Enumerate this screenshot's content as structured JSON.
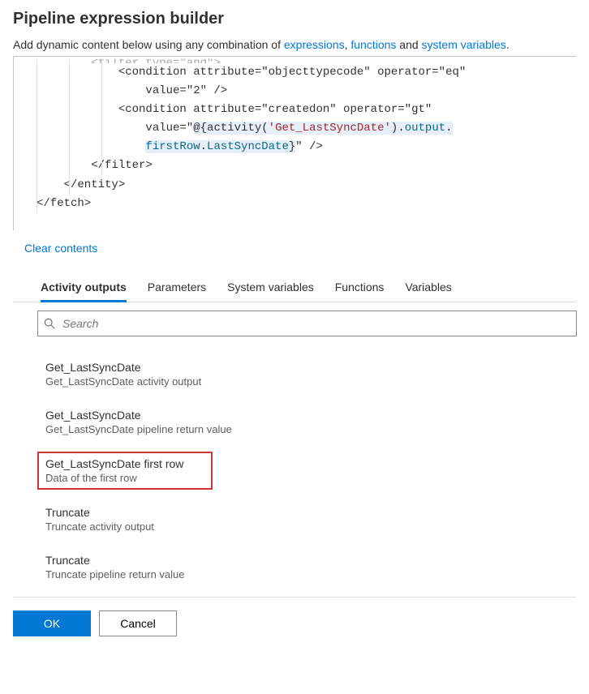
{
  "header": {
    "title": "Pipeline expression builder",
    "subtitle_prefix": "Add dynamic content below using any combination of ",
    "link_expressions": "expressions",
    "comma_sep": ", ",
    "link_functions": "functions",
    "and_sep": " and ",
    "link_sysvars": "system variables",
    "period": "."
  },
  "editor": {
    "lines": [
      {
        "indent": 2,
        "raw": "<filter type=\"and\">",
        "faded": true
      },
      {
        "indent": 3,
        "raw_pre": "<condition attribute=\"objecttypecode\" operator=\"eq\""
      },
      {
        "indent": 4,
        "raw_pre": "value=\"2\" />"
      },
      {
        "indent": 3,
        "raw_pre": "<condition attribute=\"createdon\" operator=\"gt\""
      },
      {
        "indent": 4,
        "expr_line1_prefix": "value=\"",
        "expr_at": "@{",
        "expr_fn": "activity",
        "expr_open": "(",
        "expr_arg": "'Get_LastSyncDate'",
        "expr_close": ")",
        "expr_dot1": ".",
        "expr_prop1": "output",
        "expr_tail_dot": "."
      },
      {
        "indent": 4,
        "expr_prop2": "firstRow",
        "expr_dot2": ".",
        "expr_prop3": "LastSyncDate",
        "expr_end": "}\" />"
      },
      {
        "indent": 2,
        "raw_pre": "</filter>"
      },
      {
        "indent": 1,
        "raw_pre": "</entity>"
      },
      {
        "indent": 0,
        "raw_pre": "</fetch>"
      }
    ],
    "clear_label": "Clear contents"
  },
  "tabs": {
    "activity_outputs": "Activity outputs",
    "parameters": "Parameters",
    "system_variables": "System variables",
    "functions": "Functions",
    "variables": "Variables"
  },
  "search": {
    "placeholder": "Search"
  },
  "results": [
    {
      "title": "Get_LastSyncDate",
      "sub": "Get_LastSyncDate activity output",
      "highlight": false
    },
    {
      "title": "Get_LastSyncDate",
      "sub": "Get_LastSyncDate pipeline return value",
      "highlight": false
    },
    {
      "title": "Get_LastSyncDate first row",
      "sub": "Data of the first row",
      "highlight": true
    },
    {
      "title": "Truncate",
      "sub": "Truncate activity output",
      "highlight": false
    },
    {
      "title": "Truncate",
      "sub": "Truncate pipeline return value",
      "highlight": false
    }
  ],
  "footer": {
    "ok": "OK",
    "cancel": "Cancel"
  }
}
